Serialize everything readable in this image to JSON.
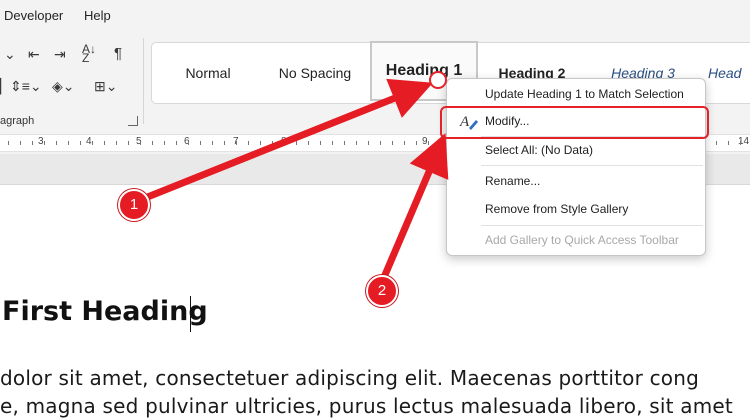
{
  "menubar": {
    "items": [
      "Developer",
      "Help"
    ]
  },
  "ribbon": {
    "group_label": "agraph",
    "styles": [
      "Normal",
      "No Spacing",
      "Heading 1",
      "Heading 2",
      "Heading 3",
      "Head"
    ],
    "icons": [
      "decrease-indent-icon",
      "increase-indent-icon",
      "sort-icon",
      "pilcrow-icon",
      "line-spacing-icon",
      "shading-icon",
      "borders-icon",
      "dialog-launcher-icon"
    ]
  },
  "ruler": {
    "numbers": [
      "3",
      "4",
      "5",
      "6",
      "7",
      "8",
      "9",
      "14"
    ]
  },
  "context_menu": {
    "items": [
      {
        "label": "Update Heading 1 to Match Selection",
        "disabled": false
      },
      {
        "label": "Modify...",
        "disabled": false
      },
      {
        "label": "Select All: (No Data)",
        "disabled": false
      },
      {
        "label": "Rename...",
        "disabled": false
      },
      {
        "label": "Remove from Style Gallery",
        "disabled": false
      },
      {
        "label": "Add Gallery to Quick Access Toolbar",
        "disabled": true
      }
    ]
  },
  "document": {
    "heading": "First Heading",
    "body_lines": [
      "dolor sit amet, consectetuer adipiscing elit. Maecenas porttitor cong",
      "e, magna sed pulvinar ultricies, purus lectus malesuada libero, sit amet"
    ]
  },
  "annotations": {
    "step1": "1",
    "step2": "2",
    "color": "#e51c23"
  }
}
